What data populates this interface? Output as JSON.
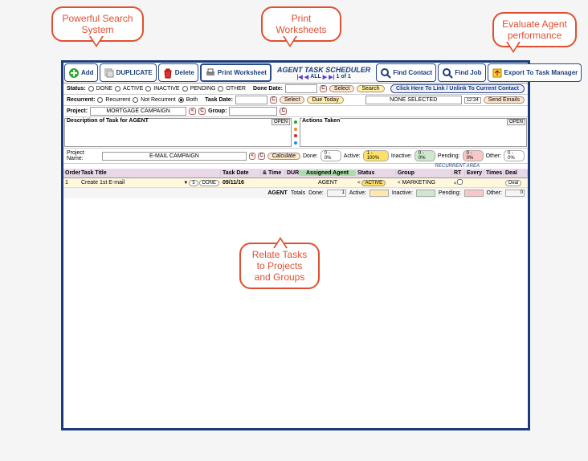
{
  "callouts": {
    "search": "Powerful Search System",
    "print": "Print Worksheets",
    "eval": "Evaluate Agent performance",
    "relate": "Relate Tasks to Projects and Groups"
  },
  "title": "AGENT TASK SCHEDULER",
  "pager": {
    "all": "ALL",
    "count": "1 of 1"
  },
  "toolbar": {
    "add": "Add",
    "duplicate": "DUPLICATE",
    "delete": "Delete",
    "print": "Print Worksheet",
    "find_contact": "Find Contact",
    "find_job": "Find Job",
    "export": "Export To Task Manager"
  },
  "filters": {
    "status_label": "Status:",
    "status_opts": [
      "DONE",
      "ACTIVE",
      "INACTIVE",
      "PENDING",
      "OTHER"
    ],
    "recurrent_label": "Recurrent:",
    "recurrent_opts": [
      "Recurrent",
      "Not Recurrent",
      "Both"
    ],
    "project_label": "Project:",
    "project_value": "MORTGAGE CAMPAIGN",
    "done_date": "Done Date:",
    "task_date": "Task Date:",
    "group": "Group:",
    "select": "Select",
    "search": "Search",
    "due_today": "Due Today",
    "link_notice": "Click Here To Link / Unlink To Current Contact",
    "none_selected": "NONE SELECTED",
    "time": "12:34",
    "send_emails": "Send Emails"
  },
  "desc": {
    "label": "Description of Task for AGENT",
    "actions": "Actions Taken",
    "open": "OPEN"
  },
  "project_row": {
    "label": "Project Name:",
    "value": "E-MAIL CAMPAIGN",
    "calc": "Calculate",
    "stats": {
      "done_l": "Done:",
      "done_v": "0 - 0%",
      "active_l": "Active:",
      "active_v": "1 - 100%",
      "inactive_l": "Inactive:",
      "inactive_v": "0 - 0%",
      "pending_l": "Pending:",
      "pending_v": "0 - 0%",
      "other_l": "Other:",
      "other_v": "0 - 0%"
    },
    "recurrent_area": "RECURRENT AREA"
  },
  "columns": {
    "order": "Order",
    "title": "Task Title",
    "date": "Task Date",
    "time": "& Time",
    "dur": "DUR",
    "agent": "Assigned Agent",
    "status": "Status",
    "group": "Group",
    "rt": "RT",
    "every": "Every",
    "times": "Times",
    "act": "Deal"
  },
  "rows": [
    {
      "order": "1",
      "title": "Create 1st E-mail",
      "n": "5",
      "status_chip": "DONE",
      "date": "09/11/16",
      "agent": "AGENT",
      "status": "ACTIVE",
      "group": "MARKETING"
    }
  ],
  "totals": {
    "label": "AGENT",
    "t": "Totals",
    "done_l": "Done:",
    "done": "1",
    "active_l": "Active:",
    "inactive_l": "Inactive:",
    "pending_l": "Pending:",
    "other_l": "Other:",
    "zero": "0"
  }
}
